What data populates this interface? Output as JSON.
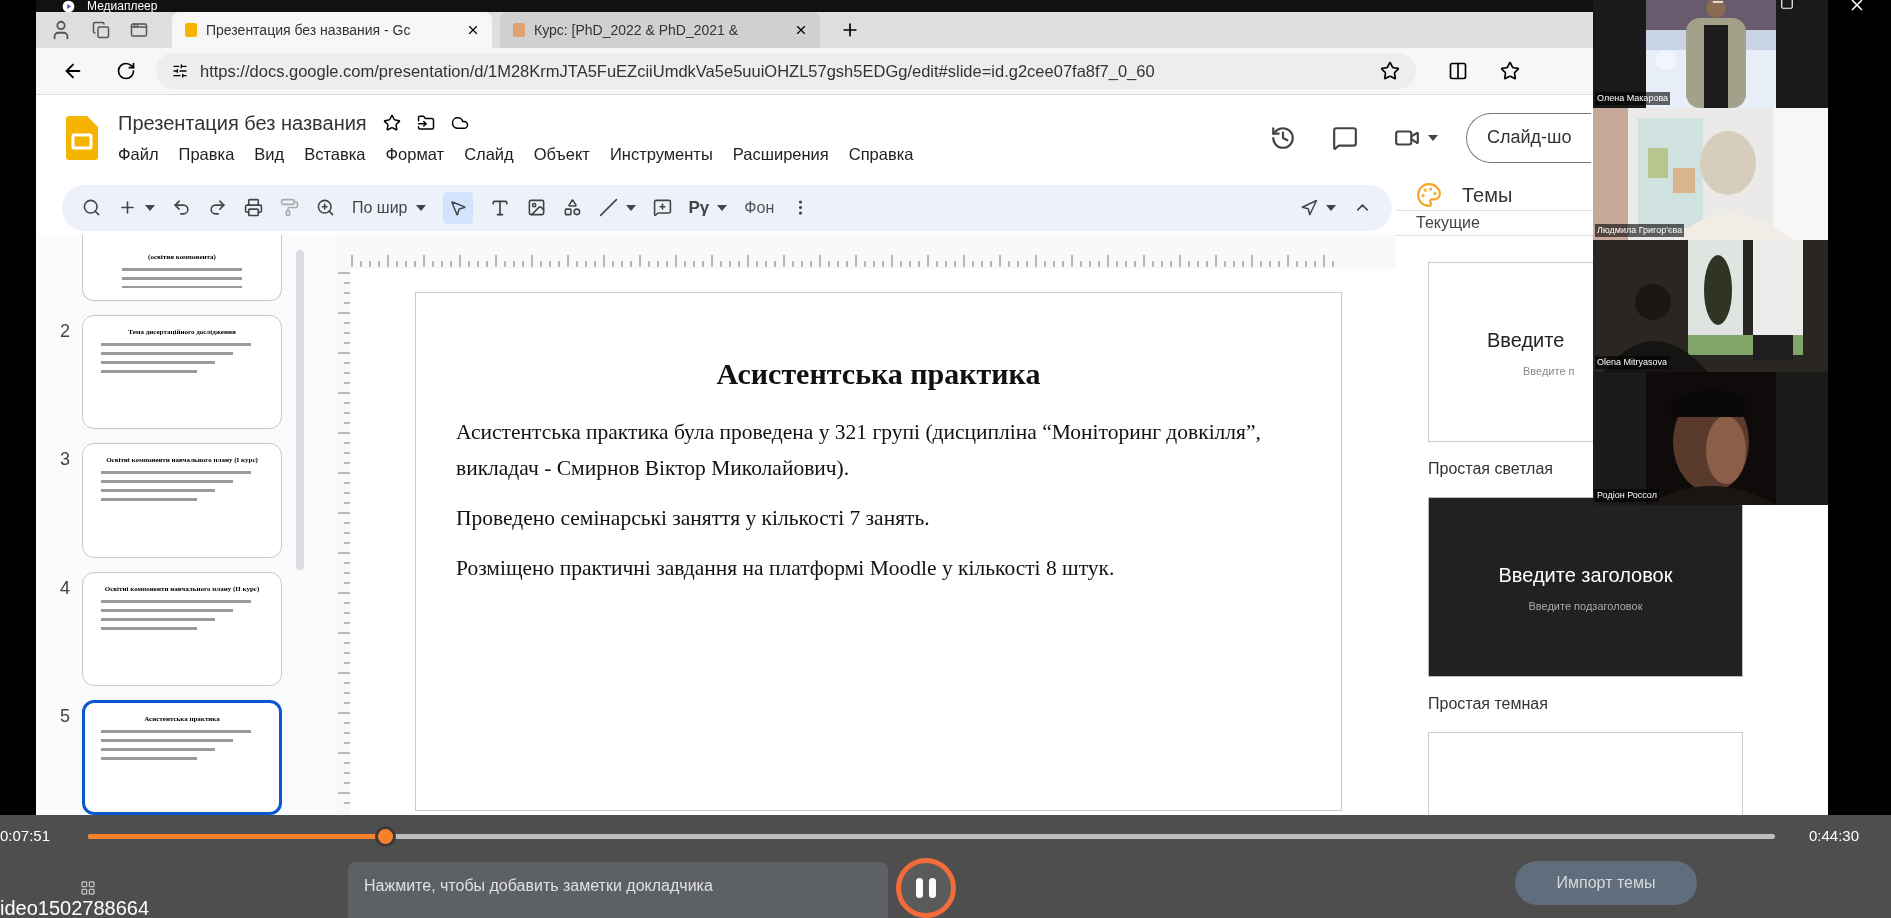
{
  "player": {
    "title": "Медиаплеер",
    "elapsed": "0:07:51",
    "total": "0:44:30",
    "progress": {
      "level": 0.176
    },
    "file_name": "ideo1502788664",
    "playing": true
  },
  "browser": {
    "tabs": [
      {
        "label": "Презентация без названия - Gc",
        "selected": true
      },
      {
        "label": "Курс: [PhD_2022 & PhD_2021 &",
        "selected": false
      }
    ],
    "url": "https://docs.google.com/presentation/d/1M28KrmJTA5FuEZciiUmdkVa5e5uuiOHZL57gsh5EDGg/edit#slide=id.g2cee07fa8f7_0_60"
  },
  "docs": {
    "title": "Презентация без названия",
    "menu": [
      "Файл",
      "Правка",
      "Вид",
      "Вставка",
      "Формат",
      "Слайд",
      "Объект",
      "Инструменты",
      "Расширения",
      "Справка"
    ],
    "slideshow_button": "Слайд-шо",
    "toolbar": {
      "zoom": "По шир",
      "select_tool": {
        "selected": true
      },
      "input_tools": "Pγ",
      "background": "Фон"
    }
  },
  "slides": [
    {
      "title": "(освітня компонента)",
      "selected": false
    },
    {
      "number": "2",
      "title": "Тема дисертаційного дослідження",
      "selected": false
    },
    {
      "number": "3",
      "title": "Освітні компоненти навчального плану (I курс)",
      "selected": false
    },
    {
      "number": "4",
      "title": "Освітні компоненти навчального плану (II курс)",
      "selected": false
    },
    {
      "number": "5",
      "title": "Асистентська практика",
      "selected": true
    }
  ],
  "slide": {
    "title": "Асистентська практика",
    "paragraphs": [
      "Асистентська практика була проведена у 321 групі (дисципліна “Моніторинг довкілля”, викладач - Смирнов Віктор Миколайович).",
      "Проведено семінарські заняття у кількості 7 занять.",
      "Розміщено практичні завдання на платформі Moodle у кількості 8 штук."
    ]
  },
  "notes_placeholder": "Нажмите, чтобы добавить заметки докладчика",
  "themes": {
    "title": "Темы",
    "section": "Текущие",
    "items": [
      {
        "kind": "light",
        "title": "Введите",
        "subtitle": "Введите п",
        "name": "Простая светлая"
      },
      {
        "kind": "dark",
        "title": "Введите заголовок",
        "subtitle": "Введите подзаголовок",
        "name": "Простая темная"
      },
      {
        "kind": "light"
      }
    ],
    "import_button": "Импорт темы"
  },
  "participants": [
    {
      "name": "Олена Макарова"
    },
    {
      "name": "Людмила Григор'єва"
    },
    {
      "name": "Olena Mitryasova"
    },
    {
      "name": "Родіон Россол"
    }
  ]
}
